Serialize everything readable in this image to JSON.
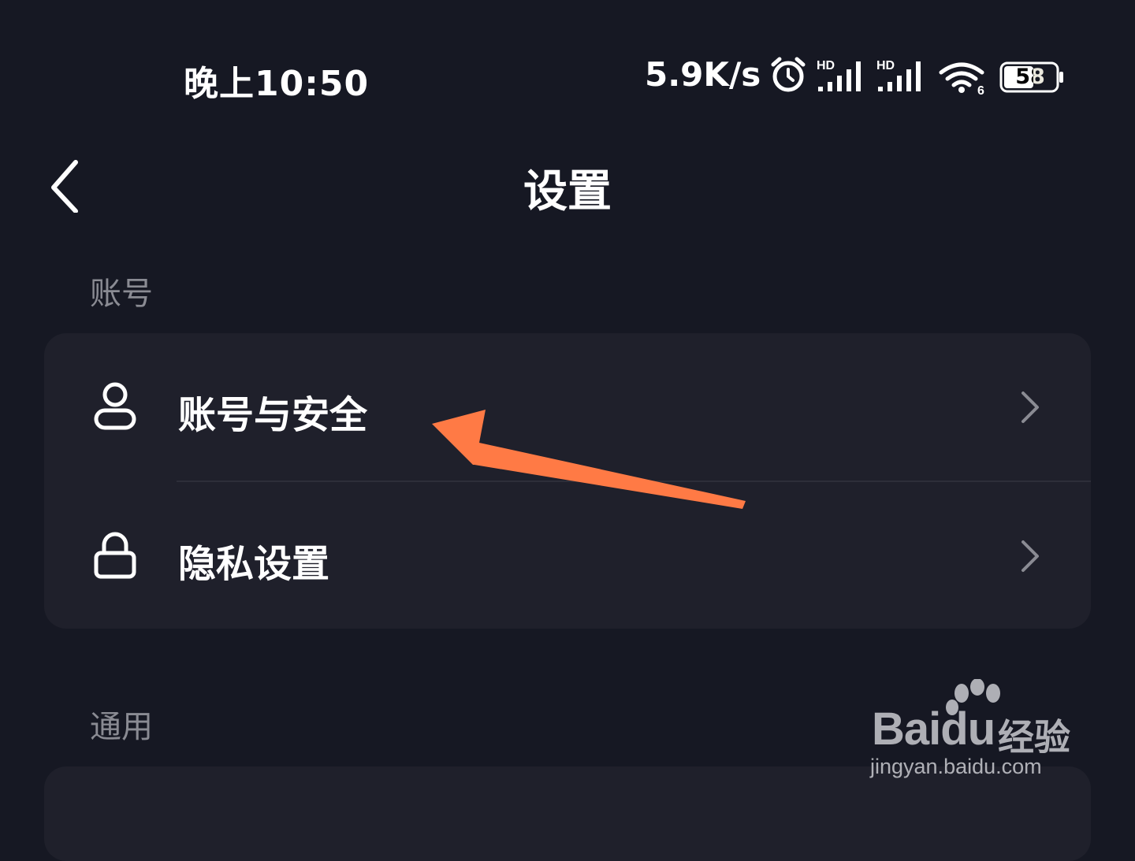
{
  "status_bar": {
    "time": "晚上10:50",
    "net_speed": "5.9K/s",
    "signal1_label": "HD",
    "signal2_label": "HD",
    "wifi_label": "6",
    "battery": "58",
    "icons": [
      "alarm-icon",
      "signal-icon",
      "signal-icon",
      "wifi-icon",
      "battery-icon"
    ]
  },
  "header": {
    "title": "设置",
    "back_icon": "chevron-left-icon"
  },
  "sections": [
    {
      "label": "账号",
      "items": [
        {
          "label": "账号与安全",
          "icon": "user-icon"
        },
        {
          "label": "隐私设置",
          "icon": "lock-icon"
        }
      ]
    },
    {
      "label": "通用",
      "items": []
    }
  ],
  "annotation": {
    "color": "#ff7a45"
  },
  "watermark": {
    "logo": "Bai",
    "logo_paw": "du",
    "brand": "经验",
    "url": "jingyan.baidu.com"
  },
  "colors": {
    "background": "#161823",
    "card": "#1f202b",
    "section_label": "#8a8b93",
    "chevron": "#8a8b93"
  }
}
